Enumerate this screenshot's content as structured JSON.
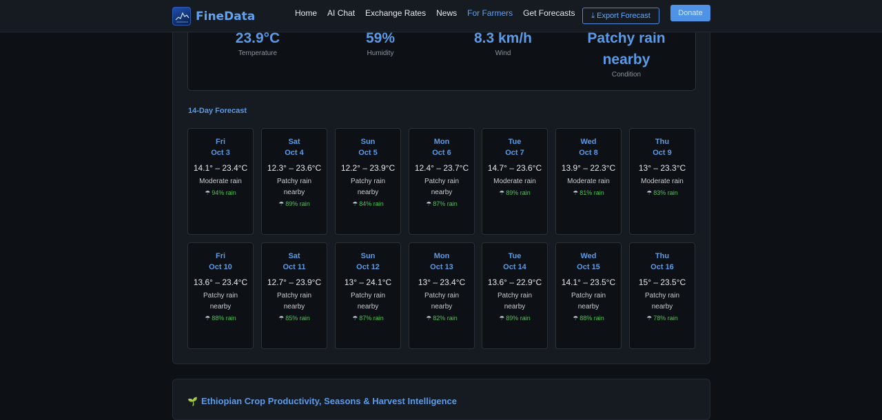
{
  "nav": {
    "brand": "FineData",
    "links": [
      "Home",
      "AI Chat",
      "Exchange Rates",
      "News",
      "For Farmers",
      "Get Forecasts"
    ],
    "active_link": "For Farmers",
    "export_label": "Export Forecast",
    "donate_label": "Donate"
  },
  "current": {
    "temperature": {
      "value": "23.9°C",
      "label": "Temperature"
    },
    "humidity": {
      "value": "59%",
      "label": "Humidity"
    },
    "wind": {
      "value": "8.3 km/h",
      "label": "Wind"
    },
    "condition": {
      "value_line1": "Patchy rain",
      "value_line2": "nearby",
      "label": "Condition"
    }
  },
  "forecast_title": "14-Day Forecast",
  "forecast": [
    {
      "day": "Fri",
      "date": "Oct 3",
      "temp": "14.1° – 23.4°C",
      "cond": "Moderate rain",
      "rain": "94% rain"
    },
    {
      "day": "Sat",
      "date": "Oct 4",
      "temp": "12.3° – 23.6°C",
      "cond": "Patchy rain nearby",
      "rain": "89% rain"
    },
    {
      "day": "Sun",
      "date": "Oct 5",
      "temp": "12.2° – 23.9°C",
      "cond": "Patchy rain nearby",
      "rain": "84% rain"
    },
    {
      "day": "Mon",
      "date": "Oct 6",
      "temp": "12.4° – 23.7°C",
      "cond": "Patchy rain nearby",
      "rain": "87% rain"
    },
    {
      "day": "Tue",
      "date": "Oct 7",
      "temp": "14.7° – 23.6°C",
      "cond": "Moderate rain",
      "rain": "89% rain"
    },
    {
      "day": "Wed",
      "date": "Oct 8",
      "temp": "13.9° – 22.3°C",
      "cond": "Moderate rain",
      "rain": "81% rain"
    },
    {
      "day": "Thu",
      "date": "Oct 9",
      "temp": "13° – 23.3°C",
      "cond": "Moderate rain",
      "rain": "83% rain"
    },
    {
      "day": "Fri",
      "date": "Oct 10",
      "temp": "13.6° – 23.4°C",
      "cond": "Patchy rain nearby",
      "rain": "88% rain"
    },
    {
      "day": "Sat",
      "date": "Oct 11",
      "temp": "12.7° – 23.9°C",
      "cond": "Patchy rain nearby",
      "rain": "85% rain"
    },
    {
      "day": "Sun",
      "date": "Oct 12",
      "temp": "13° – 24.1°C",
      "cond": "Patchy rain nearby",
      "rain": "87% rain"
    },
    {
      "day": "Mon",
      "date": "Oct 13",
      "temp": "13° – 23.4°C",
      "cond": "Patchy rain nearby",
      "rain": "82% rain"
    },
    {
      "day": "Tue",
      "date": "Oct 14",
      "temp": "13.6° – 22.9°C",
      "cond": "Patchy rain nearby",
      "rain": "89% rain"
    },
    {
      "day": "Wed",
      "date": "Oct 15",
      "temp": "14.1° – 23.5°C",
      "cond": "Patchy rain nearby",
      "rain": "88% rain"
    },
    {
      "day": "Thu",
      "date": "Oct 16",
      "temp": "15° – 23.5°C",
      "cond": "Patchy rain nearby",
      "rain": "78% rain"
    }
  ],
  "crop_section_title": "Ethiopian Crop Productivity, Seasons & Harvest Intelligence",
  "icons": {
    "rain": "rain-cloud-icon",
    "download": "download-icon",
    "sprout": "sprout-icon"
  }
}
